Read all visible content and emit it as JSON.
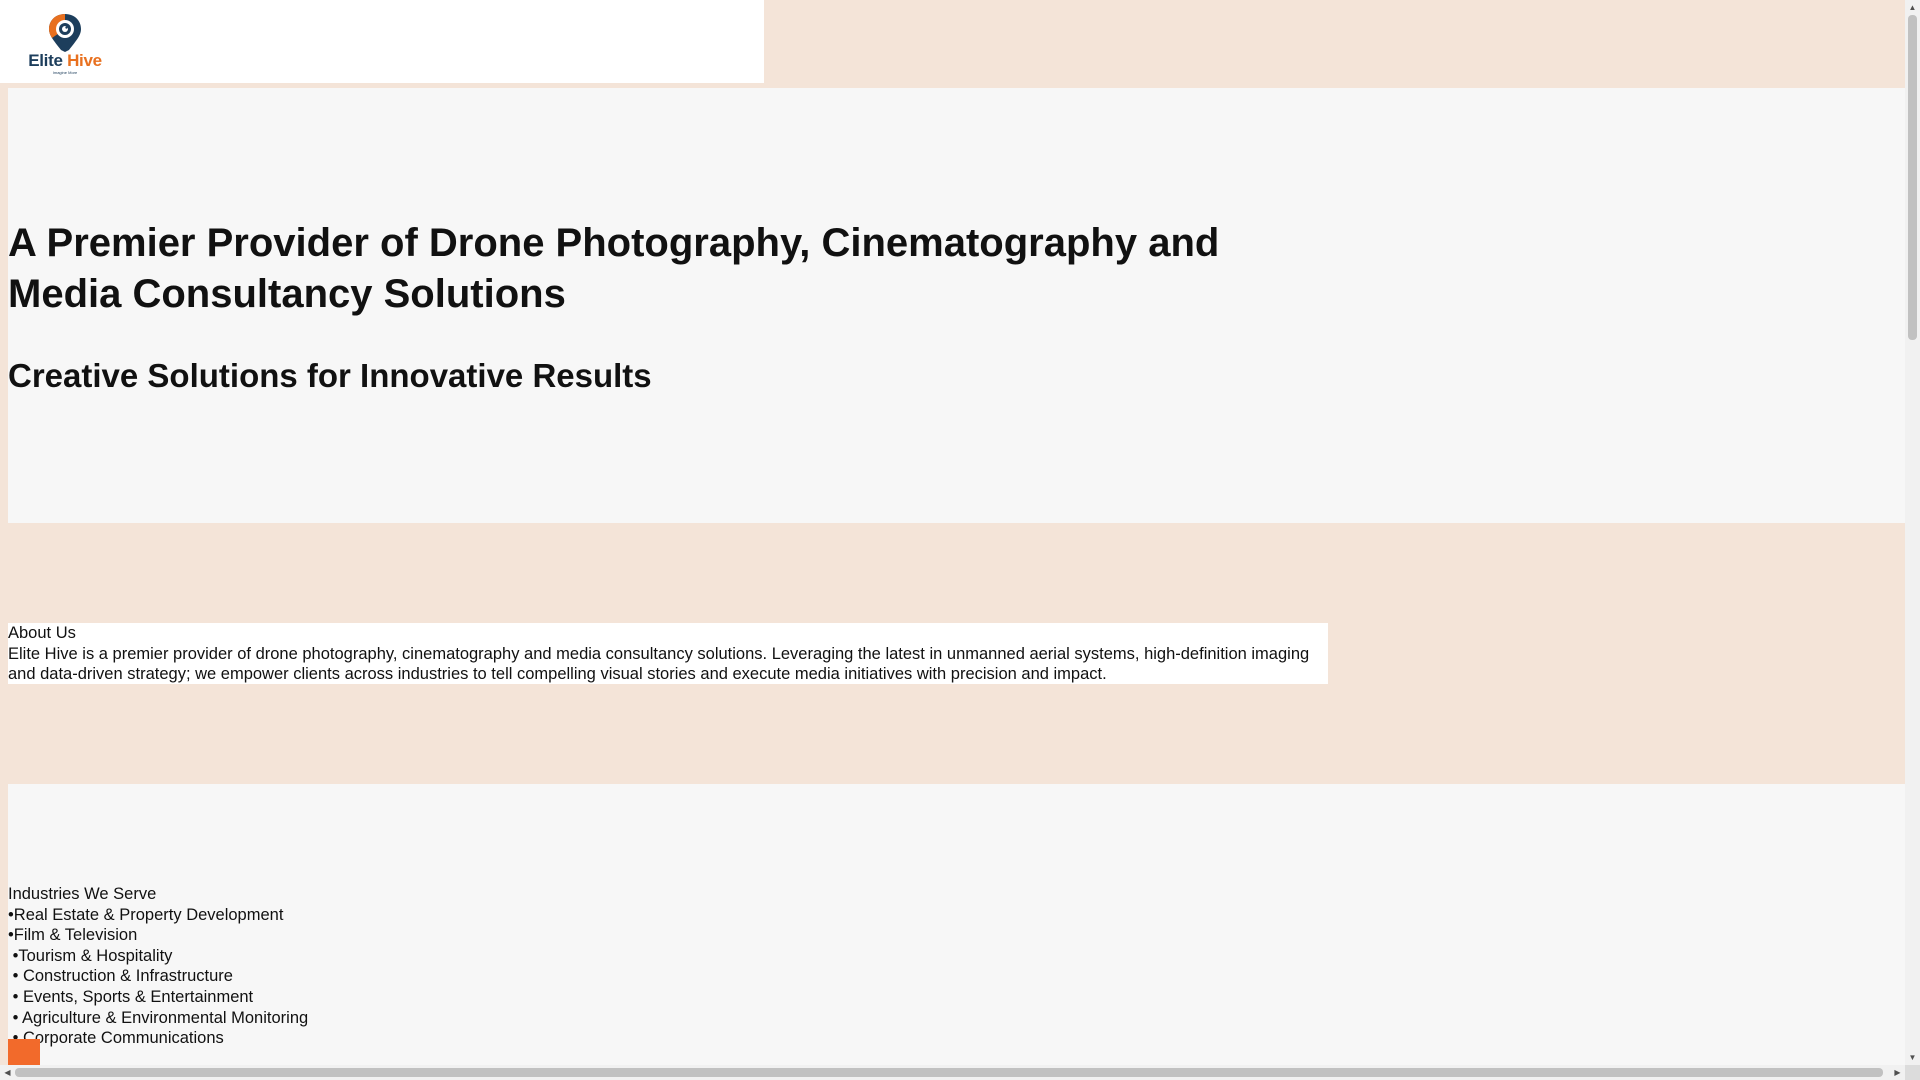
{
  "header": {
    "logo": {
      "brand_first": "Elite",
      "brand_second": "Hive",
      "tagline": "Imagine More",
      "icon": "camera-pin-icon",
      "colors": {
        "navy": "#1d3e5c",
        "orange": "#e8701f"
      }
    }
  },
  "hero": {
    "heading_line1": "A Premier Provider of Drone Photography, Cinematography and",
    "heading_line2": "Media Consultancy Solutions",
    "subheading": "Creative Solutions for Innovative Results"
  },
  "about": {
    "title": "About Us",
    "body": "Elite Hive is a premier provider of drone photography, cinematography and media consultancy solutions. Leveraging the latest in unmanned aerial systems, high-definition imaging and data-driven strategy; we empower clients across industries to tell compelling visual stories and execute media initiatives with precision and impact."
  },
  "industries": {
    "title": "Industries We Serve",
    "items": [
      "•Real Estate & Property Development",
      "•Film & Television",
      " •Tourism & Hospitality",
      " • Construction & Infrastructure",
      " • Events, Sports & Entertainment",
      " • Agriculture & Environmental Monitoring",
      " • Corporate Communications"
    ]
  },
  "colors": {
    "page_background": "#f4e4d8",
    "section_background": "#f7f7f7",
    "accent": "#f26a2b"
  },
  "scrollbars": {
    "up_arrow": "▲",
    "down_arrow": "▼",
    "left_arrow": "◀",
    "right_arrow": "▶"
  }
}
